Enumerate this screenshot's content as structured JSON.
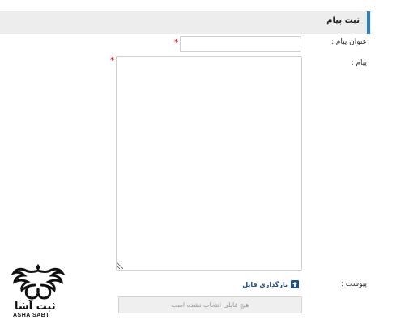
{
  "header": {
    "title": "ثبت پیام"
  },
  "form": {
    "subject_label": "عنوان پیام :",
    "subject_value": "",
    "message_label": "پیام :",
    "message_value": "",
    "required_mark": "*",
    "attachment_label": "پیوست :",
    "upload_label": "بارگذاری فایل",
    "file_status": "هیچ فایلی انتخاب نشده است"
  },
  "logo": {
    "word": "ثبت آشا",
    "sub": "ASHA SABT"
  },
  "colors": {
    "accent": "#2a7fc1",
    "link": "#1f4e8c",
    "required": "#dd2222"
  }
}
